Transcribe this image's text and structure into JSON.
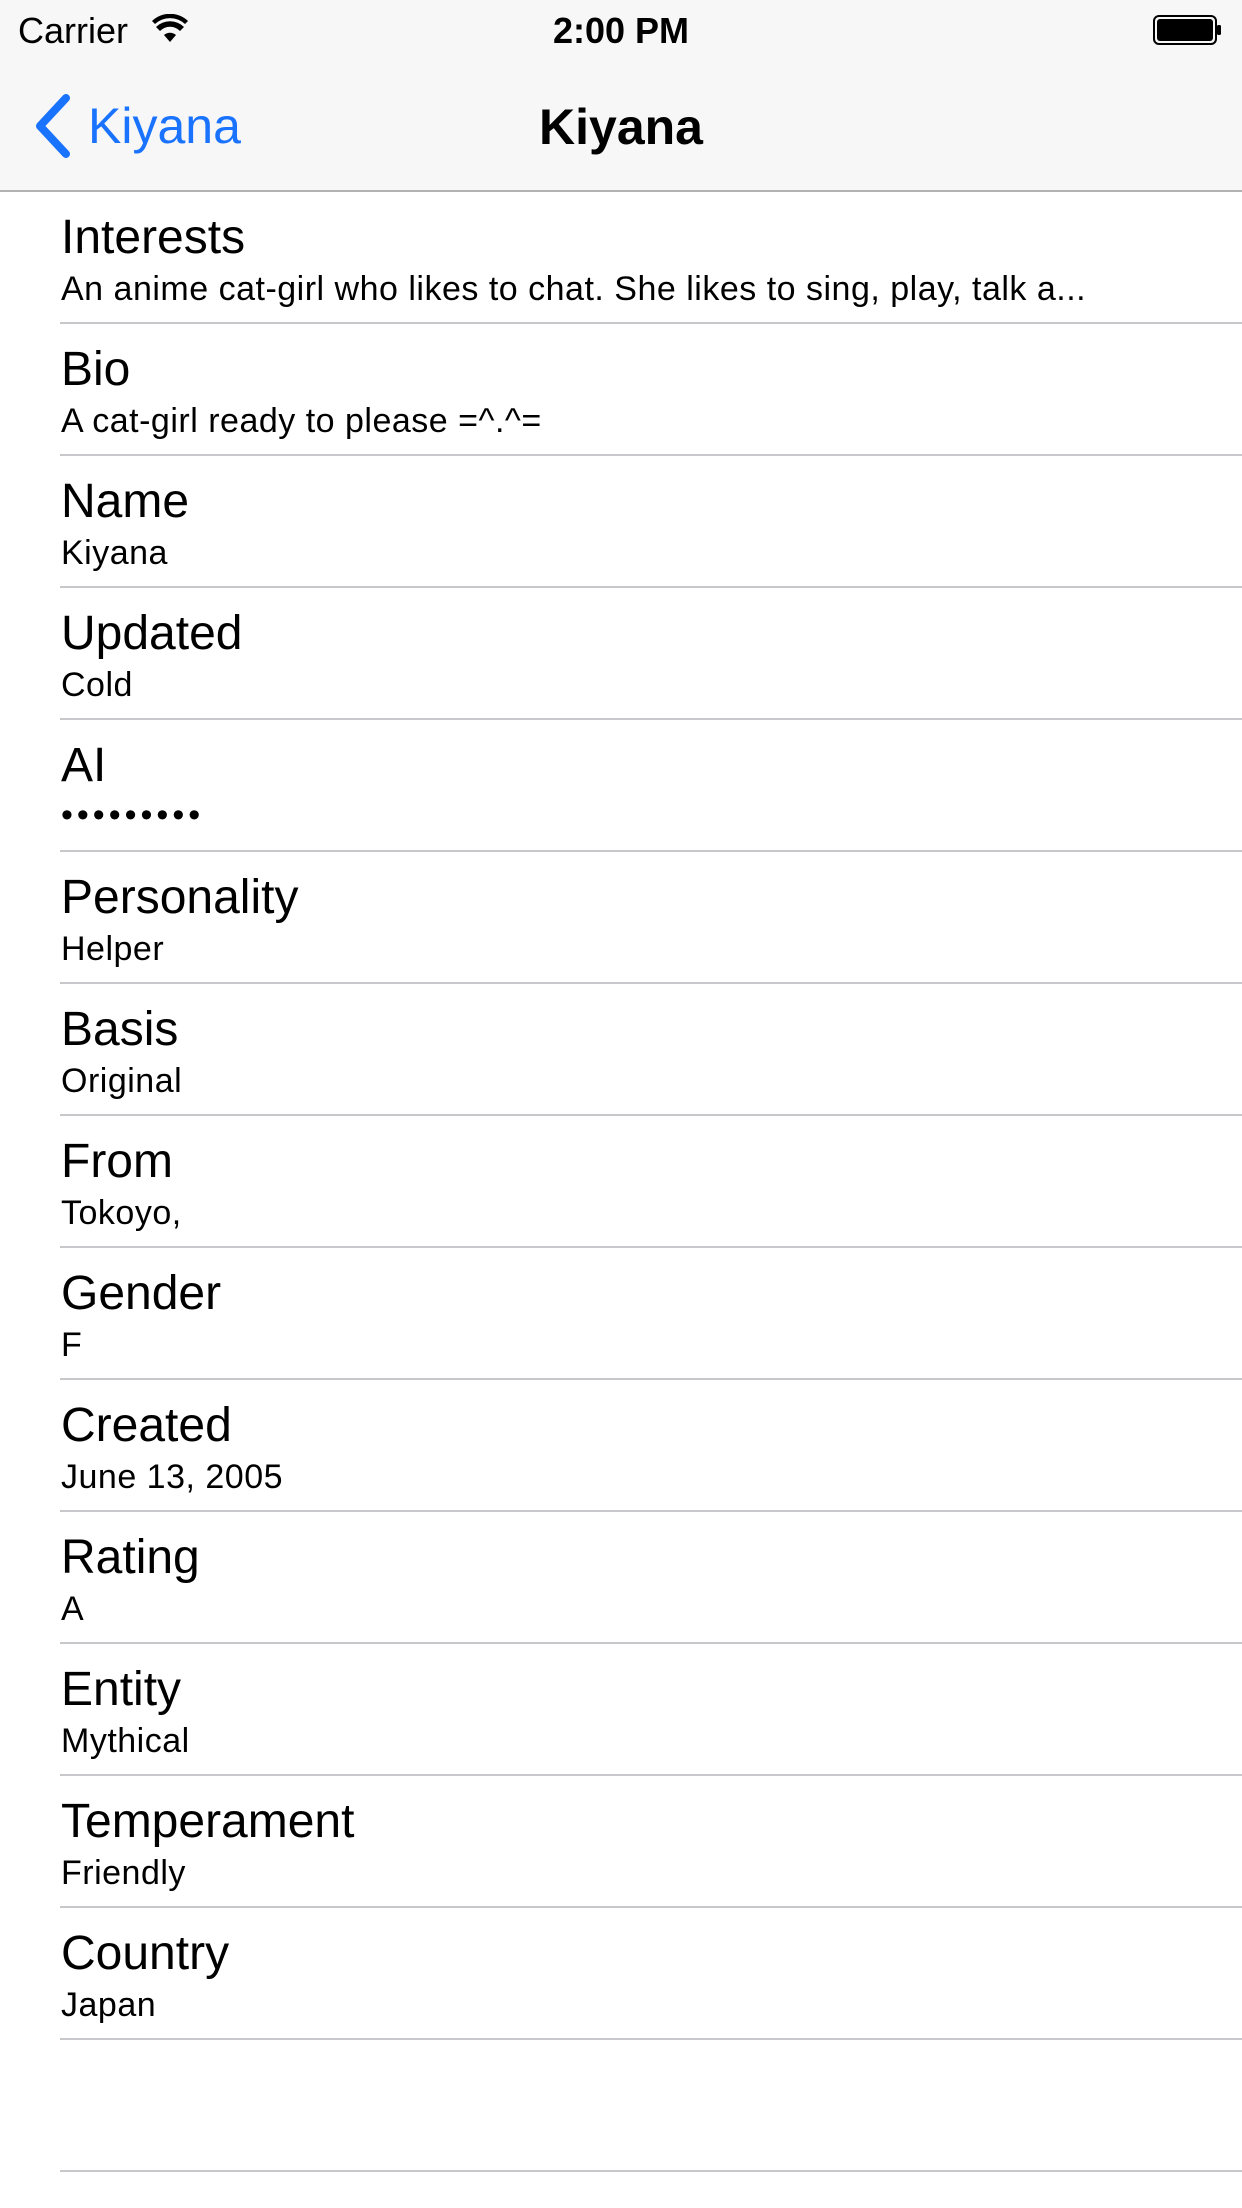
{
  "status_bar": {
    "carrier": "Carrier",
    "time": "2:00 PM",
    "wifi_icon": "wifi-icon",
    "battery_icon": "battery-icon"
  },
  "nav": {
    "back_label": "Kiyana",
    "title": "Kiyana",
    "accent_color": "#1a73ff"
  },
  "rows": [
    {
      "title": "Interests",
      "detail": "An anime cat-girl who likes to chat. She likes to sing, play, talk a..."
    },
    {
      "title": "Bio",
      "detail": "A cat-girl ready to please =^.^="
    },
    {
      "title": "Name",
      "detail": "Kiyana"
    },
    {
      "title": "Updated",
      "detail": "Cold"
    },
    {
      "title": "AI",
      "detail": "•••••••••"
    },
    {
      "title": "Personality",
      "detail": "Helper"
    },
    {
      "title": "Basis",
      "detail": "Original"
    },
    {
      "title": "From",
      "detail": "Tokoyo,"
    },
    {
      "title": "Gender",
      "detail": "F"
    },
    {
      "title": "Created",
      "detail": "June 13, 2005"
    },
    {
      "title": "Rating",
      "detail": "A"
    },
    {
      "title": "Entity",
      "detail": "Mythical"
    },
    {
      "title": "Temperament",
      "detail": "Friendly"
    },
    {
      "title": "Country",
      "detail": "Japan"
    }
  ]
}
